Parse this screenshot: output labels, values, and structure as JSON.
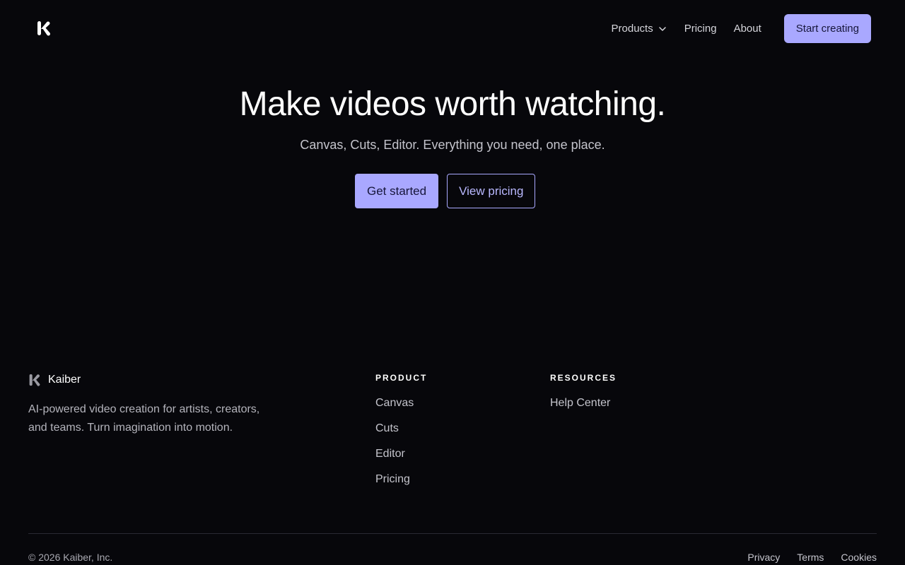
{
  "colors": {
    "background": "#07070b",
    "accent": "#a9a8ff",
    "accent_text": "#16163a"
  },
  "header": {
    "logo_icon": "kaiber-k-logo-icon",
    "nav": [
      {
        "label": "Products",
        "icon": "chevron-down-icon"
      },
      {
        "label": "Pricing"
      },
      {
        "label": "About"
      }
    ],
    "cta_label": "Start creating"
  },
  "hero": {
    "title": "Make videos worth watching.",
    "subtitle": "Canvas, Cuts, Editor. Everything you need, one place.",
    "primary_cta": "Get started",
    "secondary_cta": "View pricing"
  },
  "footer": {
    "brand_name": "Kaiber",
    "description": "AI-powered video creation for artists, creators, and teams. Turn imagination into motion.",
    "columns": [
      {
        "heading": "PRODUCT",
        "links": [
          "Canvas",
          "Cuts",
          "Editor",
          "Pricing"
        ]
      },
      {
        "heading": "RESOURCES",
        "links": [
          "Help Center"
        ]
      }
    ],
    "copyright": "© 2026 Kaiber, Inc.",
    "legal": [
      "Privacy",
      "Terms",
      "Cookies"
    ]
  }
}
